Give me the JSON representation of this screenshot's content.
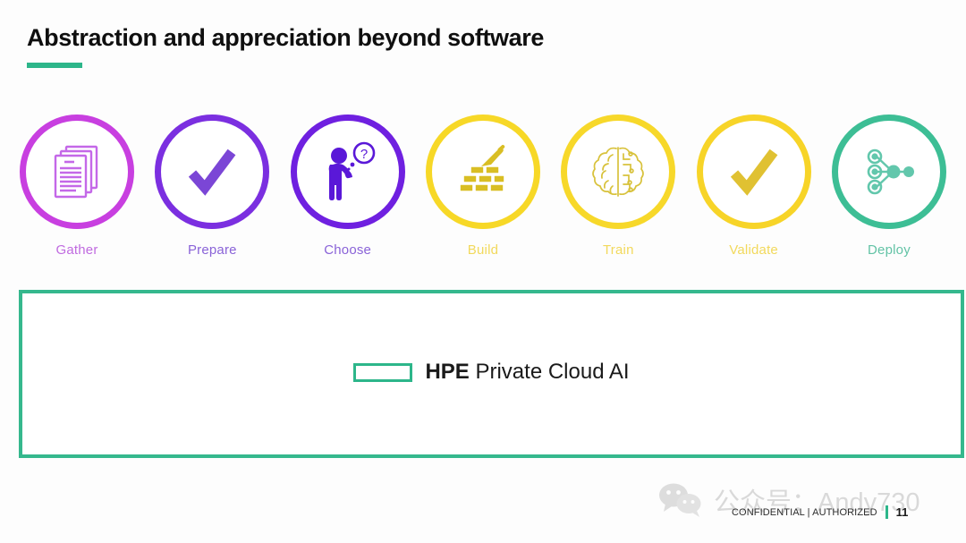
{
  "slide": {
    "title": "Abstraction and appreciation beyond software",
    "accent_color": "#2DB68A",
    "background_color": "#FDFDFD"
  },
  "pipeline": {
    "stages": [
      {
        "label": "Gather",
        "icon": "documents-stack-icon",
        "ring_color": "#C83FE0",
        "icon_color": "#C468E8",
        "label_color": "#C06BE0"
      },
      {
        "label": "Prepare",
        "icon": "checkmark-icon",
        "ring_color": "#7B2FE0",
        "icon_color": "#7B46D6",
        "label_color": "#8A63D8"
      },
      {
        "label": "Choose",
        "icon": "person-question-icon",
        "ring_color": "#6F20E0",
        "icon_color": "#5A18D8",
        "label_color": "#8A63D8"
      },
      {
        "label": "Build",
        "icon": "bricks-trowel-icon",
        "ring_color": "#F7D827",
        "icon_color": "#D9BE24",
        "label_color": "#F2D95C"
      },
      {
        "label": "Train",
        "icon": "brain-circuit-icon",
        "ring_color": "#F7D82A",
        "icon_color": "#D8C23C",
        "label_color": "#F2D95C"
      },
      {
        "label": "Validate",
        "icon": "checkmark-icon",
        "ring_color": "#F7D428",
        "icon_color": "#E0C132",
        "label_color": "#F2D95C"
      },
      {
        "label": "Deploy",
        "icon": "network-nodes-icon",
        "ring_color": "#3DBE95",
        "icon_color": "#62C7AC",
        "label_color": "#63C3A6"
      }
    ]
  },
  "product_box": {
    "border_color": "#35B88D",
    "logo_icon": "hpe-logo-mark",
    "brand": "HPE",
    "product": " Private Cloud AI"
  },
  "watermark": {
    "icon": "wechat-icon",
    "text": "公众号：Andy730",
    "color": "#BDBDBD"
  },
  "footer": {
    "confidential": "CONFIDENTIAL | AUTHORIZED",
    "separator_color": "#2DB68A",
    "page_number": "11"
  }
}
